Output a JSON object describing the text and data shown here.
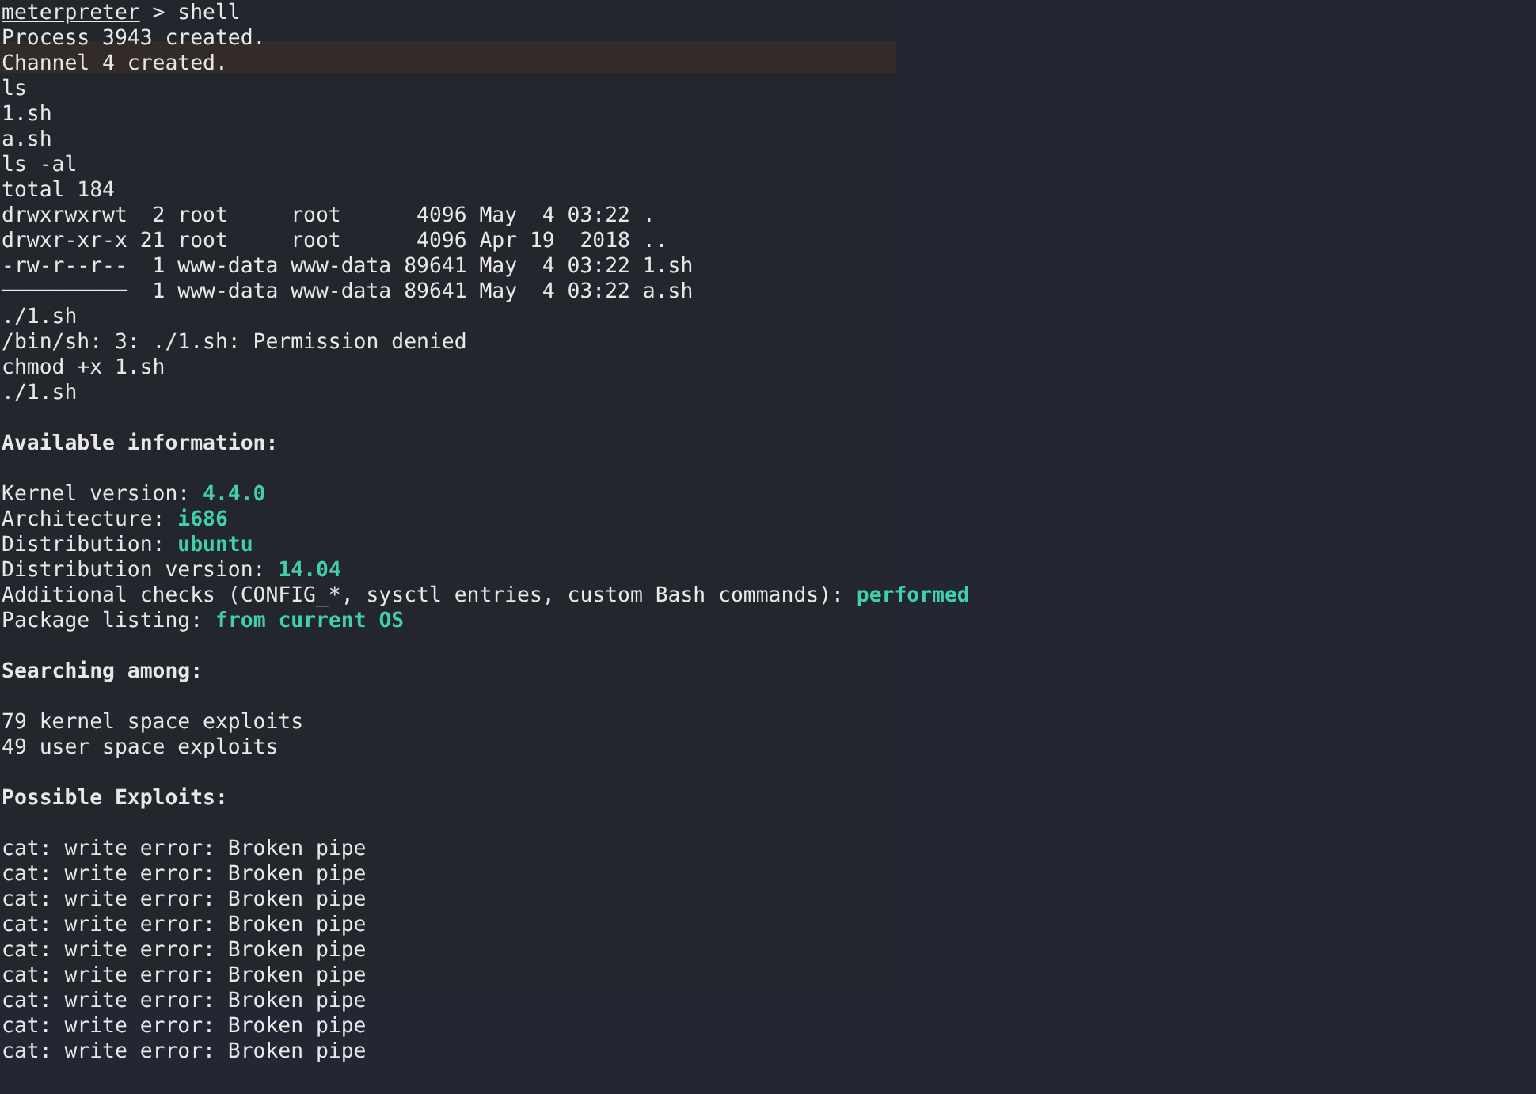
{
  "terminal": {
    "lines": [
      {
        "kind": "prompt",
        "prompt": "meterpreter",
        "command": "> shell"
      },
      {
        "kind": "text",
        "text": "Process 3943 created."
      },
      {
        "kind": "text",
        "text": "Channel 4 created."
      },
      {
        "kind": "text",
        "text": "ls"
      },
      {
        "kind": "text",
        "text": "1.sh"
      },
      {
        "kind": "text",
        "text": "a.sh"
      },
      {
        "kind": "text",
        "text": "ls -al"
      },
      {
        "kind": "text",
        "text": "total 184"
      },
      {
        "kind": "text",
        "text": "drwxrwxrwt  2 root     root      4096 May  4 03:22 ."
      },
      {
        "kind": "text",
        "text": "drwxr-xr-x 21 root     root      4096 Apr 19  2018 .."
      },
      {
        "kind": "text",
        "text": "-rw-r--r--  1 www-data www-data 89641 May  4 03:22 1.sh"
      },
      {
        "kind": "text",
        "text": "──────────  1 www-data www-data 89641 May  4 03:22 a.sh"
      },
      {
        "kind": "text",
        "text": "./1.sh"
      },
      {
        "kind": "text",
        "text": "/bin/sh: 3: ./1.sh: Permission denied"
      },
      {
        "kind": "text",
        "text": "chmod +x 1.sh"
      },
      {
        "kind": "text",
        "text": "./1.sh"
      },
      {
        "kind": "blank"
      },
      {
        "kind": "heading",
        "text": "Available information:"
      },
      {
        "kind": "blank"
      },
      {
        "kind": "kv",
        "label": "Kernel version:",
        "value": "4.4.0"
      },
      {
        "kind": "kv",
        "label": "Architecture:",
        "value": "i686"
      },
      {
        "kind": "kv",
        "label": "Distribution:",
        "value": "ubuntu"
      },
      {
        "kind": "kv",
        "label": "Distribution version:",
        "value": "14.04"
      },
      {
        "kind": "kv",
        "label": "Additional checks (CONFIG_*, sysctl entries, custom Bash commands):",
        "value": "performed"
      },
      {
        "kind": "kv",
        "label": "Package listing:",
        "value": "from current OS"
      },
      {
        "kind": "blank"
      },
      {
        "kind": "heading",
        "text": "Searching among:"
      },
      {
        "kind": "blank"
      },
      {
        "kind": "text",
        "text": "79 kernel space exploits"
      },
      {
        "kind": "text",
        "text": "49 user space exploits"
      },
      {
        "kind": "blank"
      },
      {
        "kind": "heading",
        "text": "Possible Exploits:"
      },
      {
        "kind": "blank"
      },
      {
        "kind": "text",
        "text": "cat: write error: Broken pipe"
      },
      {
        "kind": "text",
        "text": "cat: write error: Broken pipe"
      },
      {
        "kind": "text",
        "text": "cat: write error: Broken pipe"
      },
      {
        "kind": "text",
        "text": "cat: write error: Broken pipe"
      },
      {
        "kind": "text",
        "text": "cat: write error: Broken pipe"
      },
      {
        "kind": "text",
        "text": "cat: write error: Broken pipe"
      },
      {
        "kind": "text",
        "text": "cat: write error: Broken pipe"
      },
      {
        "kind": "text",
        "text": "cat: write error: Broken pipe"
      },
      {
        "kind": "text",
        "text": "cat: write error: Broken pipe"
      }
    ]
  }
}
